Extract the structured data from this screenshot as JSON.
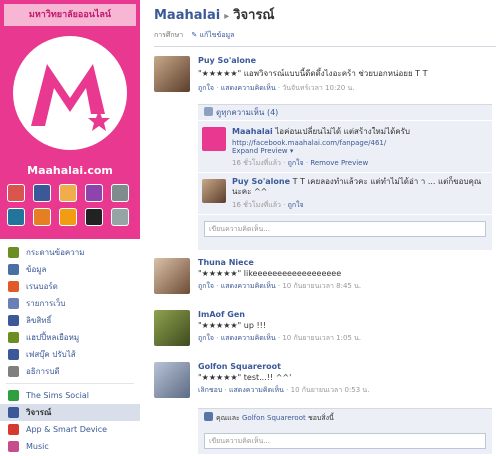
{
  "promo": {
    "title": "มหาวิทยาลัยออนไลน์",
    "site_name": "Maahalai.com",
    "accent": "#e8388f"
  },
  "nav": [
    {
      "label": "กระดานข้อความ",
      "icon": "wall-icon",
      "color": "#6b8e23"
    },
    {
      "label": "ข้อมูล",
      "icon": "info-icon",
      "color": "#4a6fa5"
    },
    {
      "label": "เรนบอร์ด",
      "icon": "board-icon",
      "color": "#e05a28"
    },
    {
      "label": "รายการเว็บ",
      "icon": "list-icon",
      "color": "#6a7fb5"
    },
    {
      "label": "ลิขสิทธิ์",
      "icon": "star-icon",
      "color": "#3b5998"
    },
    {
      "label": "แฮปปี้หลเยือหมู",
      "icon": "happy-icon",
      "color": "#6b8e23"
    },
    {
      "label": "เฟสบุ๊ค ปรับไส้",
      "icon": "facebook-icon",
      "color": "#3b5998"
    },
    {
      "label": "อธิการบดี",
      "icon": "person-icon",
      "color": "#7f7f7f"
    },
    {
      "label": "The Sims Social",
      "icon": "sims-icon",
      "color": "#2e9e3e"
    },
    {
      "label": "วิจารณ์",
      "icon": "review-icon",
      "color": "#3b5998",
      "selected": true
    },
    {
      "label": "App & Smart Device",
      "icon": "app-icon",
      "color": "#d63a2f"
    },
    {
      "label": "Music",
      "icon": "music-icon",
      "color": "#c54d8b"
    },
    {
      "label": "CityVille",
      "icon": "cityville-icon",
      "color": "#d83a2b"
    }
  ],
  "header": {
    "page_name": "Maahalai",
    "tab": "วิจารณ์",
    "sub_tab": "การศึกษา",
    "edit_label": "แก้ไขข้อมูล"
  },
  "posts": [
    {
      "author": "Puy So'alone",
      "text": "\"★★★★★\" แอพวิจารณ์แบบนี้ดีดดึ้งไงอะคร้า ช่วยบอกหน่อยย T T",
      "meta": {
        "like": "ถูกใจ",
        "comment": "แสดงความคิดเห็น",
        "time": "วันจันทร์เวลา 10:20 น."
      },
      "comments_count_label": "ดูทุกความเห็น (4)",
      "comments": [
        {
          "author": "Maahalai",
          "text": "ไอค่อนเปลี่ยนไม่ได้ แต่สร้างใหม่ได้ครับ",
          "link": "http://facebook.maahalai.com/fanpage/461/",
          "expand": "Expand Preview",
          "time": "16 ชั่วโมงที่แล้ว",
          "like": "ถูกใจ",
          "remove": "Remove Preview"
        },
        {
          "author": "Puy So'alone",
          "text": "T T เคยลองทำแล้วคะ แต่ทำไม่ได้อ่า า ... แต่ก็ขอบคุณนะคะ ^^",
          "time": "16 ชั่วโมงที่แล้ว",
          "like": "ถูกใจ"
        }
      ],
      "input_placeholder": "เขียนความคิดเห็น..."
    },
    {
      "author": "Thuna Niece",
      "text": "\"★★★★★\" likeeeeeeeeeeeeeeeeee",
      "meta": {
        "like": "ถูกใจ",
        "comment": "แสดงความคิดเห็น",
        "time": "10 กันยายนเวลา 8:45 น."
      }
    },
    {
      "author": "ImAof Gen",
      "text": "\"★★★★★\" up !!!",
      "meta": {
        "like": "ถูกใจ",
        "comment": "แสดงความคิดเห็น",
        "time": "10 กันยายนเวลา 1:05 น."
      }
    },
    {
      "author": "Golfon Squareroot",
      "text": "\"★★★★★\" test...!! ^^'",
      "meta": {
        "like": "เลิกชอบ",
        "comment": "แสดงความคิดเห็น",
        "time": "10 กันยายนเวลา 0:53 น."
      },
      "liked_by_prefix": "คุณและ",
      "liked_by_name": "Golfon Squareroot",
      "liked_by_suffix": "ชอบสิ่งนี้",
      "input_placeholder": "เขียนความคิดเห็น..."
    }
  ]
}
